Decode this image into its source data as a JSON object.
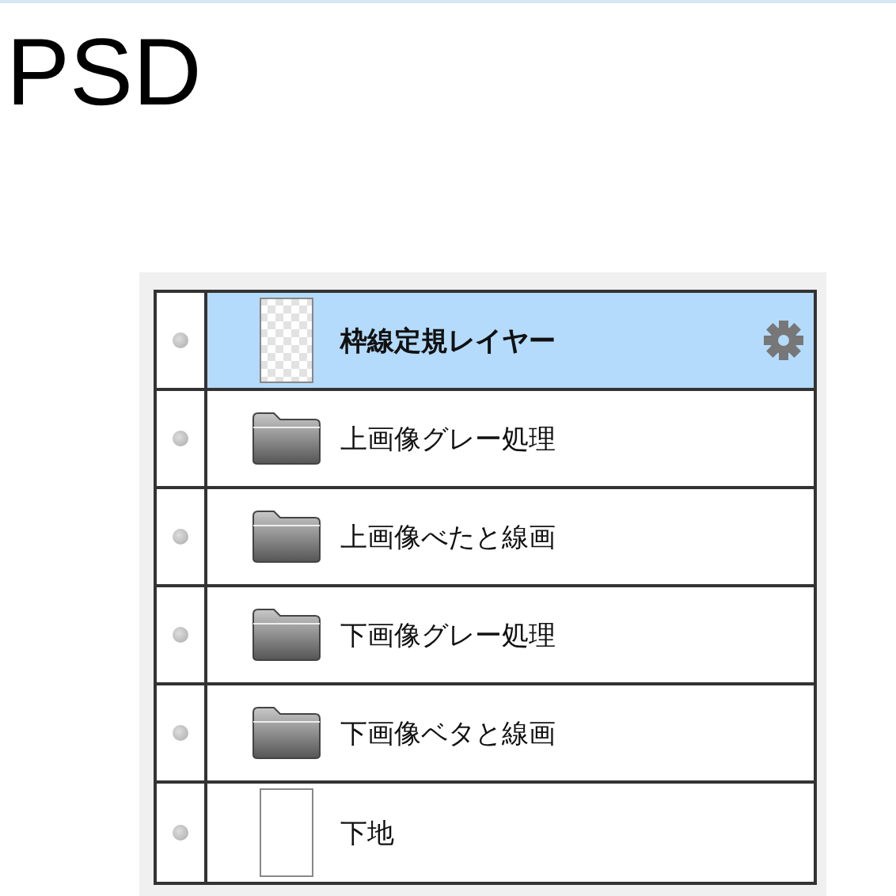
{
  "title": "PSD",
  "layers": [
    {
      "name": "枠線定規レイヤー",
      "kind": "transparent",
      "selected": true
    },
    {
      "name": "上画像グレー処理",
      "kind": "folder",
      "selected": false
    },
    {
      "name": "上画像べたと線画",
      "kind": "folder",
      "selected": false
    },
    {
      "name": "下画像グレー処理",
      "kind": "folder",
      "selected": false
    },
    {
      "name": "下画像ベタと線画",
      "kind": "folder",
      "selected": false
    },
    {
      "name": "下地",
      "kind": "blank",
      "selected": false
    }
  ]
}
